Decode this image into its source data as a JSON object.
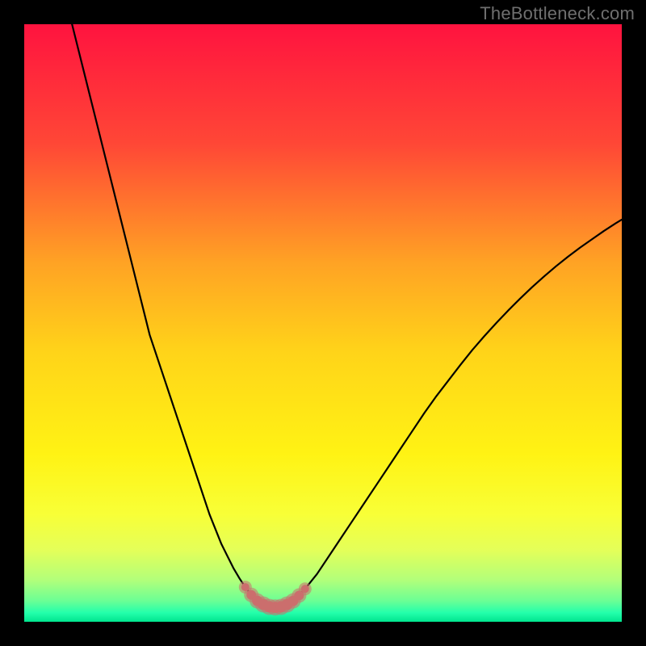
{
  "watermark": "TheBottleneck.com",
  "colors": {
    "frame_bg": "#000000",
    "curve_stroke": "#000000",
    "marker_stroke": "#cb6e6d",
    "marker_fill": "#cb6e6d",
    "gradient_stops": [
      {
        "offset": 0.0,
        "color": "#ff133f"
      },
      {
        "offset": 0.2,
        "color": "#ff4736"
      },
      {
        "offset": 0.4,
        "color": "#ffa324"
      },
      {
        "offset": 0.55,
        "color": "#ffd419"
      },
      {
        "offset": 0.72,
        "color": "#fff314"
      },
      {
        "offset": 0.82,
        "color": "#f8ff37"
      },
      {
        "offset": 0.88,
        "color": "#e4ff59"
      },
      {
        "offset": 0.93,
        "color": "#b2ff7a"
      },
      {
        "offset": 0.965,
        "color": "#6bff95"
      },
      {
        "offset": 0.985,
        "color": "#23ffab"
      },
      {
        "offset": 1.0,
        "color": "#00e48e"
      }
    ]
  },
  "chart_data": {
    "type": "line",
    "title": "",
    "xlabel": "",
    "ylabel": "",
    "xlim": [
      0,
      100
    ],
    "ylim": [
      0,
      100
    ],
    "x": [
      8,
      9,
      10,
      11,
      12,
      13,
      14,
      15,
      16,
      17,
      18,
      19,
      20,
      21,
      22,
      23,
      24,
      25,
      26,
      27,
      28,
      29,
      30,
      31,
      32,
      33,
      34,
      35,
      36,
      37,
      38,
      39,
      40,
      41,
      42,
      43,
      44,
      45,
      47,
      49,
      51,
      53,
      55,
      57,
      59,
      61,
      63,
      65,
      67,
      69,
      71,
      73,
      75,
      77,
      79,
      81,
      83,
      85,
      87,
      89,
      91,
      93,
      95,
      97,
      99,
      100
    ],
    "values": [
      100,
      96,
      92,
      88,
      84,
      80,
      76,
      72,
      68,
      64,
      60,
      56,
      52,
      48,
      45,
      42,
      39,
      36,
      33,
      30,
      27,
      24,
      21,
      18,
      15.5,
      13,
      11,
      9,
      7.3,
      5.8,
      4.5,
      3.5,
      2.9,
      2.5,
      2.4,
      2.5,
      2.9,
      3.5,
      5.5,
      8,
      11,
      14,
      17,
      20,
      23,
      26,
      29,
      32,
      35,
      37.8,
      40.4,
      43,
      45.5,
      47.8,
      50,
      52.1,
      54.1,
      56,
      57.8,
      59.5,
      61.1,
      62.6,
      64,
      65.4,
      66.7,
      67.3
    ],
    "markers": {
      "x": [
        37,
        38,
        39,
        40,
        41,
        42,
        43,
        44,
        45,
        46,
        47
      ],
      "values": [
        5.8,
        4.5,
        3.5,
        2.9,
        2.5,
        2.4,
        2.5,
        2.9,
        3.5,
        4.4,
        5.5
      ],
      "r": [
        5,
        6,
        6.5,
        7,
        7,
        7,
        7,
        7,
        6.5,
        6,
        5
      ]
    }
  }
}
